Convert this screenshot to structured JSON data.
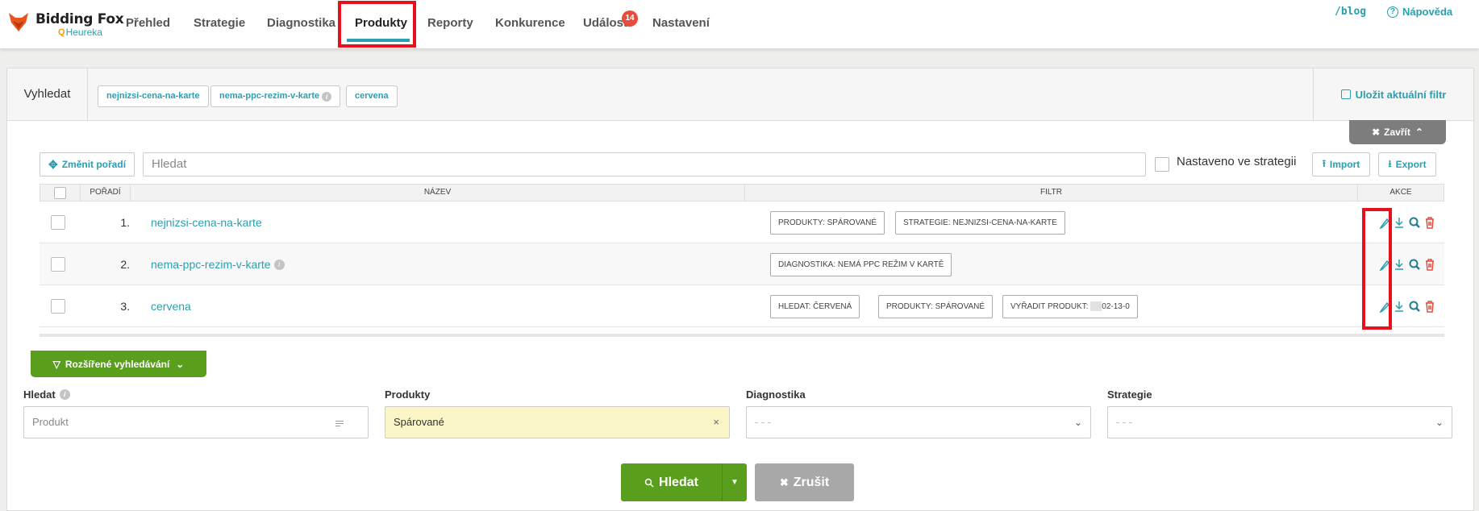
{
  "app": {
    "name": "Bidding Fox",
    "sub": "Heureka",
    "blog": "/blog",
    "help": "Nápověda"
  },
  "nav": {
    "items": [
      "Přehled",
      "Strategie",
      "Diagnostika",
      "Produkty",
      "Reporty",
      "Konkurence",
      "Události",
      "Nastavení"
    ],
    "active": "Produkty",
    "events_badge": "14"
  },
  "search_strip": {
    "label": "Vyhledat",
    "tags": [
      "nejnizsi-cena-na-karte",
      "nema-ppc-rezim-v-karte",
      "cervena"
    ],
    "save_filter": "Uložit aktuální filtr",
    "close": "Zavřít"
  },
  "toolbar": {
    "reorder": "Změnit pořadí",
    "search_placeholder": "Hledat",
    "strategy_checkbox": "Nastaveno ve strategii",
    "import": "Import",
    "export": "Export"
  },
  "table": {
    "headers": {
      "order": "POŘADÍ",
      "name": "NÁZEV",
      "filter": "FILTR",
      "actions": "AKCE"
    },
    "rows": [
      {
        "order": "1.",
        "name": "nejnizsi-cena-na-karte",
        "filters": [
          "PRODUKTY: SPÁROVANÉ",
          "STRATEGIE: NEJNIZSI-CENA-NA-KARTE"
        ]
      },
      {
        "order": "2.",
        "name": "nema-ppc-rezim-v-karte",
        "filters": [
          "DIAGNOSTIKA: NEMÁ PPC REŽIM V KARTĚ"
        ]
      },
      {
        "order": "3.",
        "name": "cervena",
        "filters": [
          "HLEDAT: ČERVENÁ",
          "PRODUKTY: SPÁROVANÉ",
          "VYŘADIT PRODUKT:",
          "02-13-0"
        ]
      }
    ]
  },
  "advanced": {
    "toggle": "Rozšířené vyhledávání",
    "fields": [
      {
        "label": "Hledat",
        "placeholder": "Produkt"
      },
      {
        "label": "Produkty",
        "value": "Spárované"
      },
      {
        "label": "Diagnostika",
        "value": "- - -"
      },
      {
        "label": "Strategie",
        "value": "- - -"
      }
    ],
    "search_button": "Hledat",
    "cancel_button": "Zrušit"
  },
  "colors": {
    "accent": "#2a9fb0",
    "green": "#5a9e1e",
    "highlight": "#e8101c",
    "danger": "#e74c3c"
  }
}
